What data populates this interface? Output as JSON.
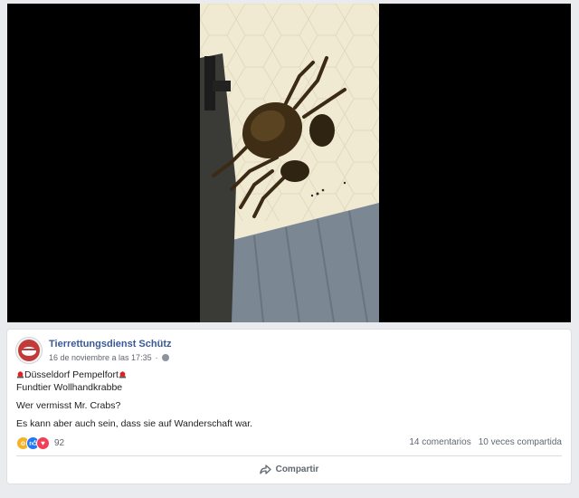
{
  "post": {
    "page_name": "Tierrettungsdienst Schütz",
    "timestamp": "16 de noviembre a las 17:35",
    "privacy_icon": "globe-icon",
    "lines": [
      "Düsseldorf Pempelfort",
      "Fundtier Wollhandkrabbe",
      "Wer vermisst Mr. Crabs?",
      "Es kann aber auch sein, dass sie auf Wanderschaft war."
    ],
    "location_emoji": "police-light-icon"
  },
  "reactions": {
    "icons": [
      "wow-icon",
      "like-icon",
      "love-icon"
    ],
    "count": "92"
  },
  "stats": {
    "comments": "14 comentarios",
    "shares": "10 veces compartida"
  },
  "actions": {
    "share_label": "Compartir",
    "share_icon": "share-arrow-icon"
  },
  "colors": {
    "link_blue": "#385898",
    "background": "#e9ebee",
    "muted_text": "#606770"
  }
}
